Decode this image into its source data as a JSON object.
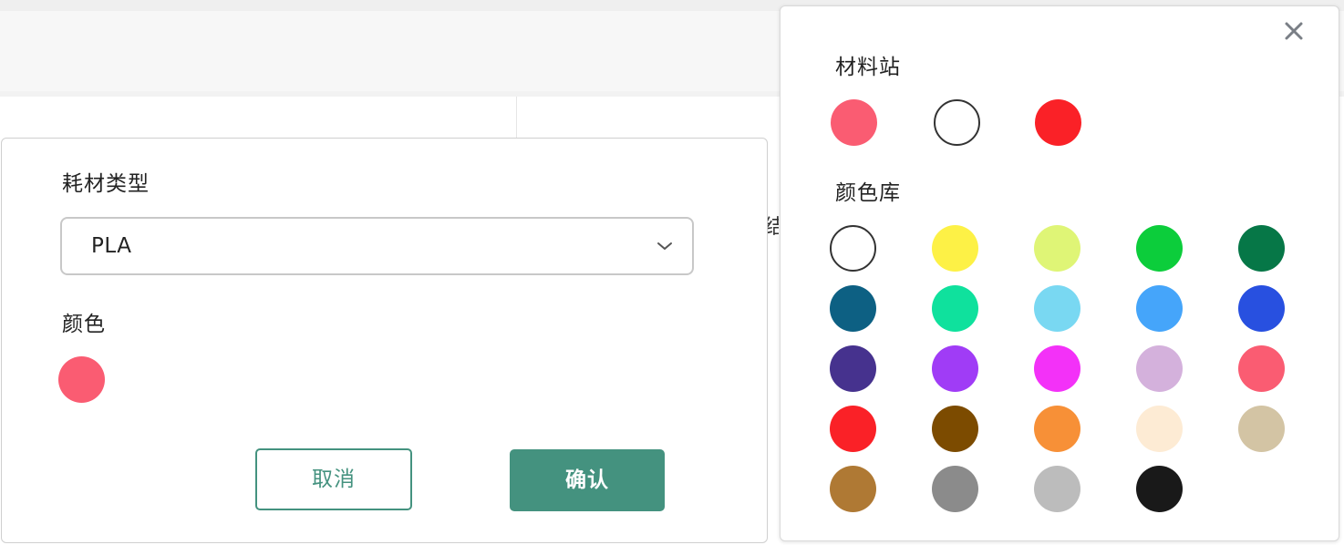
{
  "background": {
    "fragment_text": "结"
  },
  "dialog": {
    "type_label": "耗材类型",
    "type_value": "PLA",
    "color_label": "颜色",
    "current_color": "#fa5c72",
    "cancel_label": "取消",
    "confirm_label": "确认",
    "accent_color": "#44927f"
  },
  "picker": {
    "station_label": "材料站",
    "library_label": "颜色库",
    "close_icon": "close-icon",
    "station_colors": [
      "#fa5c72",
      "#ffffff",
      "#fa2127"
    ],
    "library_colors": [
      "#ffffff",
      "#fdf146",
      "#dff576",
      "#0ccd3b",
      "#067747",
      "#0d6083",
      "#0fe19d",
      "#79d8f2",
      "#45a5fa",
      "#2850e0",
      "#46328e",
      "#a03cf6",
      "#f331f8",
      "#d4b1dc",
      "#fa5c72",
      "#fa2127",
      "#7c4b00",
      "#f79037",
      "#fdebd4",
      "#d3c4a4",
      "#af7934",
      "#8b8b8b",
      "#bcbcbc",
      "#191919"
    ]
  }
}
